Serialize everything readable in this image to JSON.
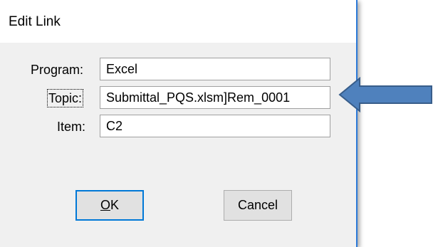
{
  "dialog": {
    "title": "Edit Link",
    "fields": [
      {
        "label": "Program:",
        "value": "Excel"
      },
      {
        "label": "Topic:",
        "value": "Submittal_PQS.xlsm]Rem_0001"
      },
      {
        "label": "Item:",
        "value": "C2"
      }
    ],
    "buttons": {
      "ok_label": "OK",
      "cancel_label": "Cancel"
    }
  },
  "annotation": {
    "arrow_fill": "#4f81bd",
    "arrow_stroke": "#385d8a",
    "arrow_icon": "left-arrow-icon"
  },
  "colors": {
    "dialog_bg": "#f0f0f0",
    "window_border": "#2b79d8",
    "default_button_border": "#0078d7"
  }
}
